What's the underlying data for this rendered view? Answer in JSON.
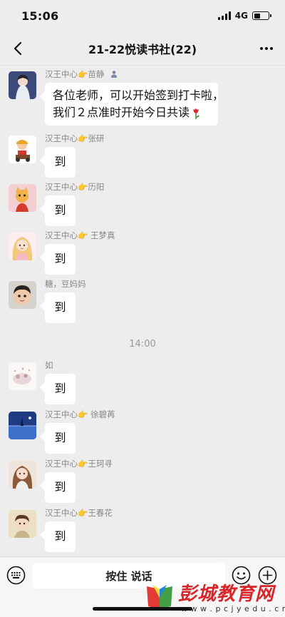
{
  "status_bar": {
    "time": "15:06",
    "network": "4G",
    "battery_level": 0.45
  },
  "nav": {
    "title": "21-22悦读书社(22)",
    "back_icon": "back-chevron-icon",
    "more_icon": "more-dots-icon"
  },
  "messages": [
    {
      "sender": "汉王中心👉苗静",
      "text_lines": [
        "各位老师，可以开始签到打卡啦，",
        "我们２点准时开始今日共读"
      ],
      "emoji": "tulip"
    },
    {
      "sender": "汉王中心👉张研",
      "text": "到"
    },
    {
      "sender": "汉王中心👉历阳",
      "text": "到"
    },
    {
      "sender": "汉王中心👉 王梦真",
      "text": "到"
    },
    {
      "sender": "糖，豆妈妈",
      "text": "到"
    },
    {
      "sender": "如",
      "text": "到"
    },
    {
      "sender": "汉王中心👉 徐碧苒",
      "text": "到"
    },
    {
      "sender": "汉王中心👉王珂寻",
      "text": "到"
    },
    {
      "sender": "汉王中心👉王春花",
      "text": "到"
    }
  ],
  "time_divider": "14:00",
  "input_bar": {
    "voice_label": "按住 说话"
  },
  "watermark": {
    "title": "彭城教育网",
    "url": "w w w . p c j y e d u . c n"
  },
  "colors": {
    "background": "#ededed",
    "bubble": "#ffffff",
    "watermark_red": "#d6262b"
  }
}
